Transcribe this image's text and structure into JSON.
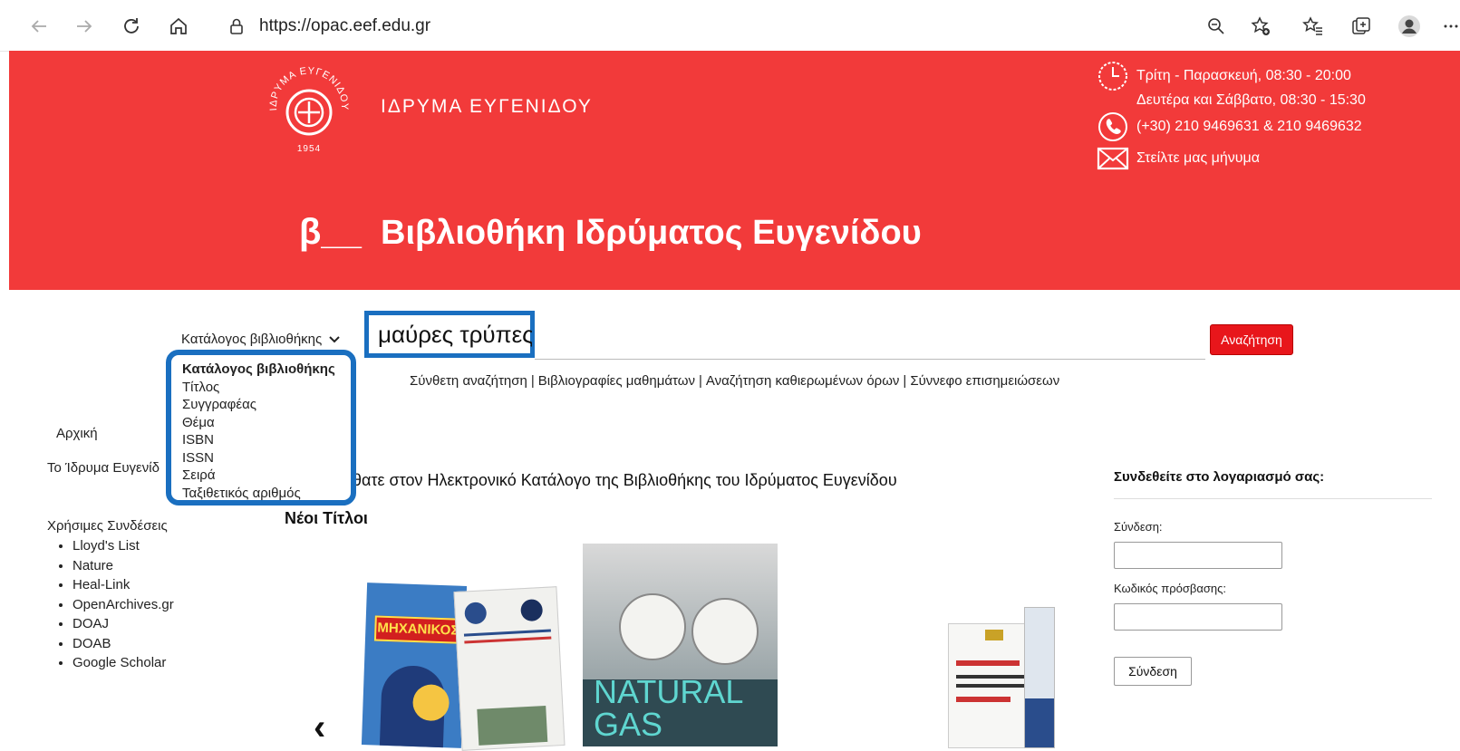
{
  "browser": {
    "url": "https://opac.eef.edu.gr"
  },
  "header": {
    "foundation_name": "ΙΔΡΥΜΑ ΕΥΓΕΝΙΔΟΥ",
    "seal_top_text": "ΙΔΡΥΜΑ ΕΥΓΕΝΙΔΟΥ",
    "seal_year": "1954",
    "beta_mark": "β__",
    "title": "Βιβλιοθήκη Ιδρύματος Ευγενίδου",
    "hours_weekday": "Τρίτη - Παρασκευή, 08:30 - 20:00",
    "hours_weekend": "Δευτέρα και Σάββατο, 08:30 - 15:30",
    "phone": "(+30) 210 9469631 & 210 9469632",
    "message_link": "Στείλτε μας μήνυμα"
  },
  "search": {
    "scope_selected": "Κατάλογος βιβλιοθήκης",
    "query": "μαύρες τρύπες",
    "button_label": "Αναζήτηση",
    "links": [
      "Σύνθετη αναζήτηση",
      "Βιβλιογραφίες μαθημάτων",
      "Αναζήτηση καθιερωμένων όρων",
      "Σύννεφο επισημειώσεων"
    ],
    "scope_options": [
      "Κατάλογος βιβλιοθήκης",
      "Τίτλος",
      "Συγγραφέας",
      "Θέμα",
      "ISBN",
      "ISSN",
      "Σειρά",
      "Ταξιθετικός αριθμός"
    ]
  },
  "sidebar": {
    "home": "Αρχική",
    "foundation": "Το Ίδρυμα Ευγενίδ",
    "useful_links_title": "Χρήσιμες Συνδέσεις",
    "useful_links": [
      "Lloyd's List",
      "Nature",
      "Heal-Link",
      "OpenArchives.gr",
      "DOAJ",
      "DOAB",
      "Google Scholar"
    ]
  },
  "main": {
    "welcome": "λθατε στον Ηλεκτρονικό Κατάλογο της Βιβλιοθήκης του Ιδρύματος Ευγενίδου",
    "new_titles": "Νέοι Τίτλοι",
    "covers": {
      "book1_title": "ΜΗΧΑΝΙΚΟΣ",
      "book3_title_line1": "NATURAL",
      "book3_title_line2": "GAS"
    },
    "carousel_prev": "‹"
  },
  "login": {
    "title": "Συνδεθείτε στο λογαριασμό σας:",
    "username_label": "Σύνδεση:",
    "password_label": "Κωδικός πρόσβασης:",
    "button_label": "Σύνδεση"
  },
  "colors": {
    "header_red": "#f23a3a",
    "button_red": "#e8161b",
    "highlight_blue": "#1a6fc0"
  }
}
